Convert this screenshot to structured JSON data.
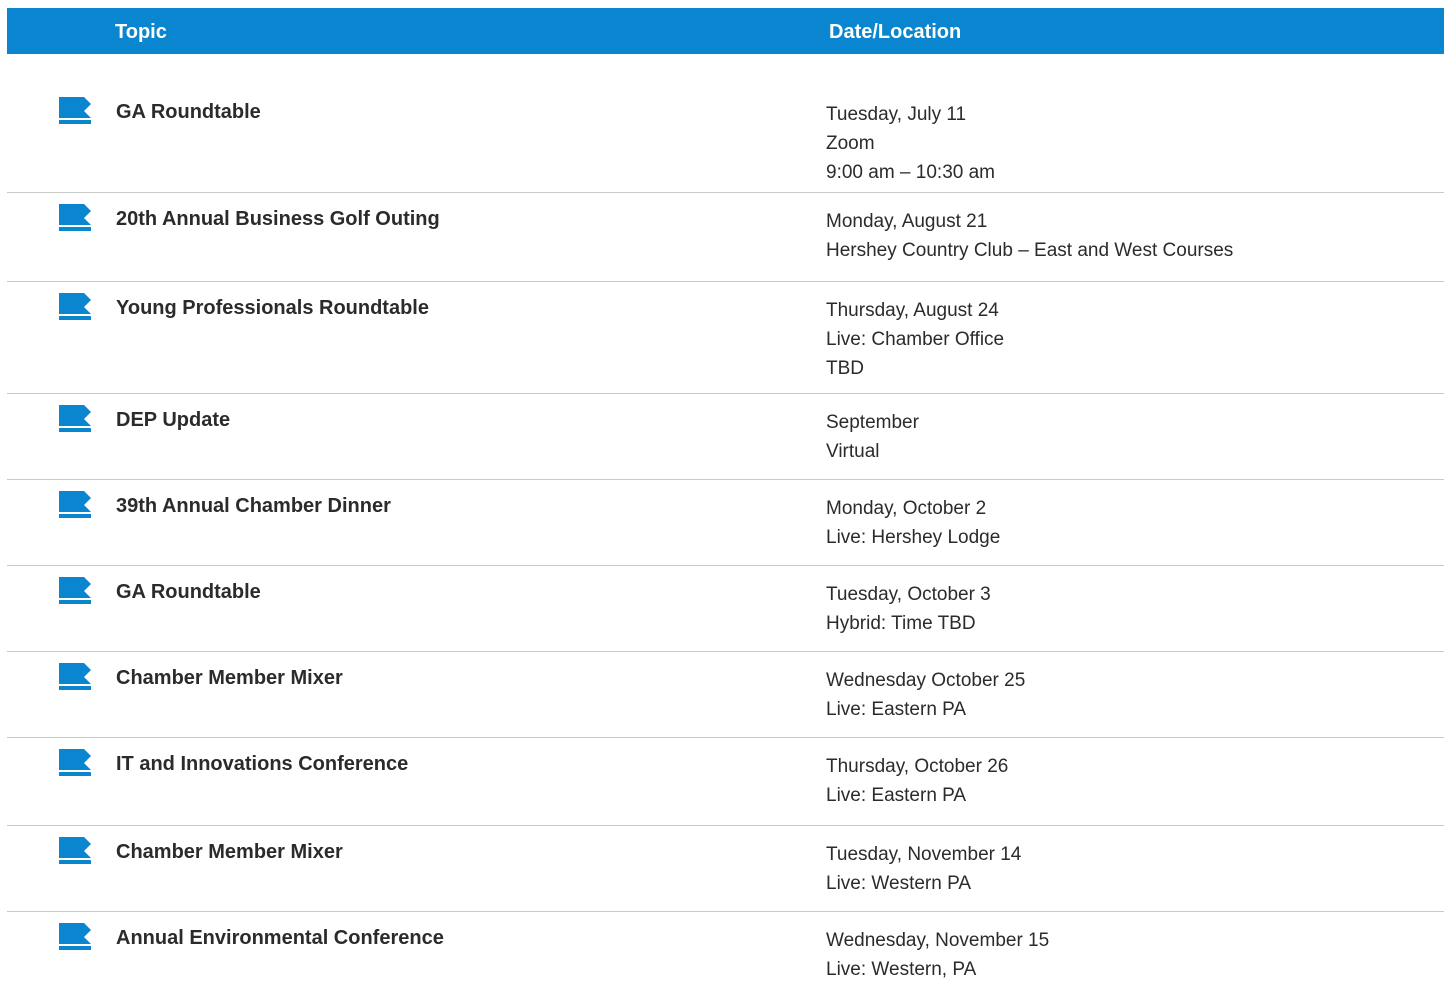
{
  "colors": {
    "header_bg": "#0a85cf",
    "icon_blue": "#0a85cf",
    "divider": "#c9c9c9"
  },
  "header": {
    "topic_label": "Topic",
    "date_label": "Date/Location"
  },
  "icon_name": "folder-icon",
  "events": [
    {
      "topic": "GA Roundtable",
      "details": [
        "Tuesday, July 11",
        "Zoom",
        "9:00 am – 10:30 am"
      ]
    },
    {
      "topic": "20th Annual Business Golf Outing",
      "details": [
        "Monday, August 21",
        "Hershey Country Club – East and West Courses"
      ]
    },
    {
      "topic": "Young Professionals Roundtable",
      "details": [
        "Thursday, August 24",
        "Live: Chamber Office",
        "TBD"
      ]
    },
    {
      "topic": "DEP Update",
      "details": [
        "September",
        "Virtual"
      ]
    },
    {
      "topic": "39th Annual Chamber Dinner",
      "details": [
        "Monday, October 2",
        "Live: Hershey Lodge"
      ]
    },
    {
      "topic": "GA Roundtable",
      "details": [
        "Tuesday, October 3",
        "Hybrid: Time TBD"
      ]
    },
    {
      "topic": "Chamber Member Mixer",
      "details": [
        "Wednesday October 25",
        "Live: Eastern PA"
      ]
    },
    {
      "topic": "IT and Innovations Conference",
      "details": [
        "Thursday, October 26",
        "Live: Eastern PA"
      ]
    },
    {
      "topic": "Chamber Member Mixer",
      "details": [
        "Tuesday, November 14",
        "Live: Western PA"
      ]
    },
    {
      "topic": "Annual Environmental Conference",
      "details": [
        "Wednesday, November 15",
        "Live: Western, PA"
      ]
    }
  ]
}
